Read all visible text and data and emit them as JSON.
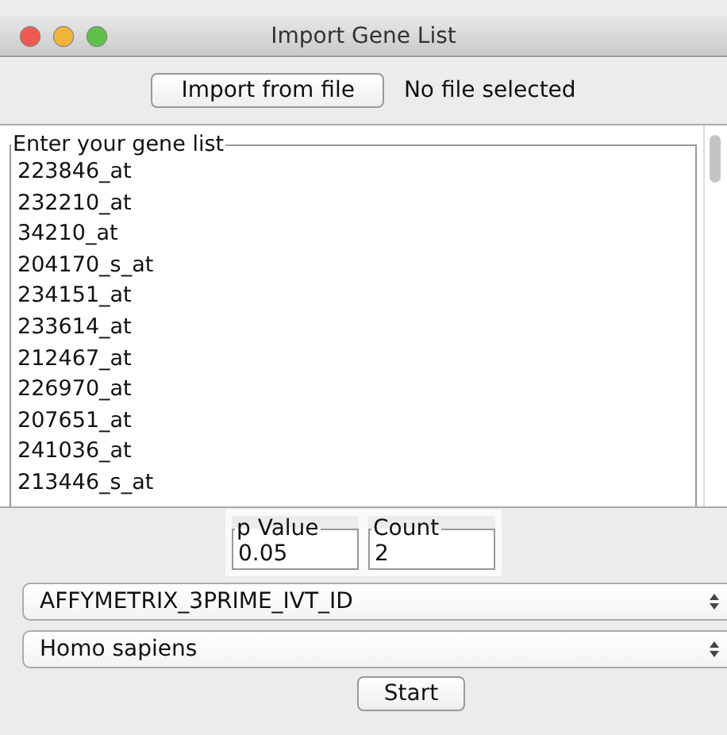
{
  "window": {
    "title": "Import Gene List"
  },
  "import": {
    "button": "Import from file",
    "status": "No file selected"
  },
  "gene_list": {
    "legend": "Enter your gene list",
    "lines": [
      "223846_at",
      "232210_at",
      "34210_at",
      "204170_s_at",
      "234151_at",
      "233614_at",
      "212467_at",
      "226970_at",
      "207651_at",
      "241036_at",
      "213446_s_at"
    ]
  },
  "fields": [
    {
      "legend": "p Value",
      "value": "0.05"
    },
    {
      "legend": "Count",
      "value": "2"
    }
  ],
  "dropdowns": [
    {
      "value": "AFFYMETRIX_3PRIME_IVT_ID"
    },
    {
      "value": "Homo sapiens"
    }
  ],
  "start_button": "Start"
}
